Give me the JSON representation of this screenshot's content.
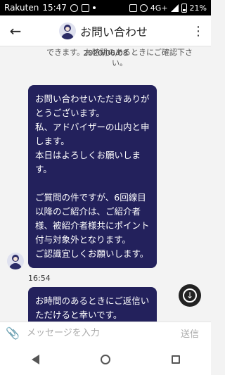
{
  "status_bar": {
    "carrier": "Rakuten",
    "time": "15:47",
    "network": "4G+",
    "battery": "21%"
  },
  "header": {
    "title": "お問い合わせ"
  },
  "chat": {
    "previous_text": "できます。お時間のあるときにご確認下さい。",
    "date": "2020/06/08",
    "messages": [
      {
        "text": "お問い合わせいただきありがとうございます。\n私、アドバイザーの山内と申します。\n本日はよろしくお願いします。\n\nご質問の件ですが、6回線目以降のご紹介は、ご紹介者様、被紹介者様共にポイント付与対象外となります。\nご認識宜しくお願いします。",
        "time": "16:54"
      },
      {
        "text": "お時間のあるときにご返信いただけると幸いです。"
      }
    ]
  },
  "composer": {
    "placeholder": "メッセージを入力",
    "send_label": "送信"
  },
  "colors": {
    "bubble": "#23215c",
    "background": "#f3f3f3"
  },
  "icons": [
    "back-arrow-icon",
    "menu-dots-icon",
    "paperclip-icon",
    "scroll-down-icon",
    "nav-back-icon",
    "nav-home-icon",
    "nav-recents-icon"
  ]
}
